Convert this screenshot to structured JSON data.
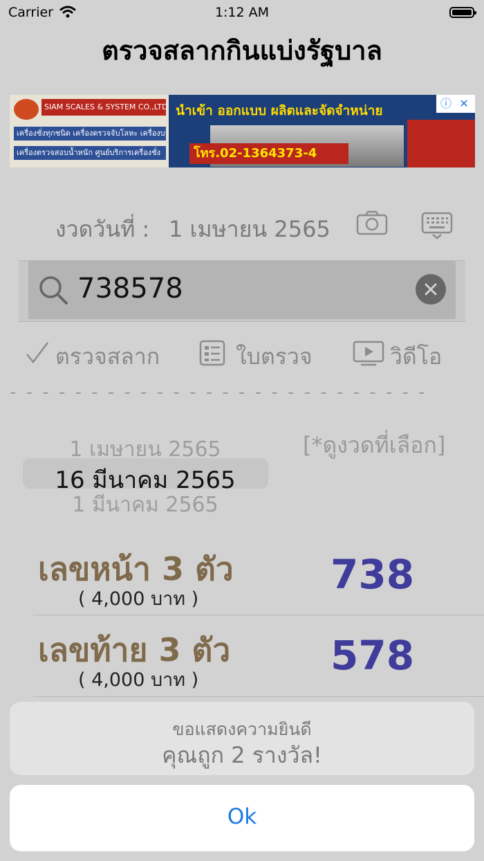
{
  "status_bar": {
    "carrier": "Carrier",
    "time": "1:12 AM"
  },
  "app": {
    "title": "ตรวจสลากกินแบ่งรัฐบาล"
  },
  "ad": {
    "company": "SIAM SCALES & SYSTEM CO.,LTD.",
    "headline": "นำเข้า ออกแบบ ผลิตและจัดจำหน่าย",
    "products_line1": "เครื่องชั่งทุกชนิด เครื่องตรวจจับโลหะ เครื่องบรรจุ",
    "products_line2": "เครื่องตรวจสอบน้ำหนัก ศูนย์บริการเครื่องชั่ง",
    "phone": "โทร.02-1364373-4",
    "adchoices_icon": "info-icon",
    "close_icon": "close-icon"
  },
  "draw": {
    "label": "งวดวันที่ :",
    "value": "1 เมษายน 2565",
    "camera_icon": "camera-icon",
    "keyboard_icon": "keyboard-icon"
  },
  "search": {
    "value": "738578",
    "search_icon": "search-icon",
    "clear_icon": "clear-icon"
  },
  "tabs": [
    {
      "label": "ตรวจสลาก",
      "icon": "checkmark-icon"
    },
    {
      "label": "ใบตรวจ",
      "icon": "document-icon"
    },
    {
      "label": "วิดีโอ",
      "icon": "video-icon"
    }
  ],
  "divider": "- - - - - - - - - - - - - - - - - - - - - - - - - -",
  "picker": {
    "previous": "1 เมษายน 2565",
    "selected": "16 มีนาคม 2565",
    "next": "1 มีนาคม 2565"
  },
  "view_selected_draw": "[*ดูงวดที่เลือก]",
  "results": [
    {
      "prize": "เลขหน้า 3 ตัว",
      "amount": "( 4,000 บาท )",
      "number": "738"
    },
    {
      "prize": "เลขท้าย 3 ตัว",
      "amount": "( 4,000 บาท )",
      "number": "578"
    }
  ],
  "alert": {
    "line1": "ขอแสดงความยินดี",
    "line2": "คุณถูก 2 รางวัล!",
    "ok": "Ok"
  },
  "colors": {
    "background": "#d2d2d2",
    "prize_name": "#7f6a4c",
    "prize_number": "#3f3c9c",
    "ok_blue": "#1a7ae6"
  }
}
